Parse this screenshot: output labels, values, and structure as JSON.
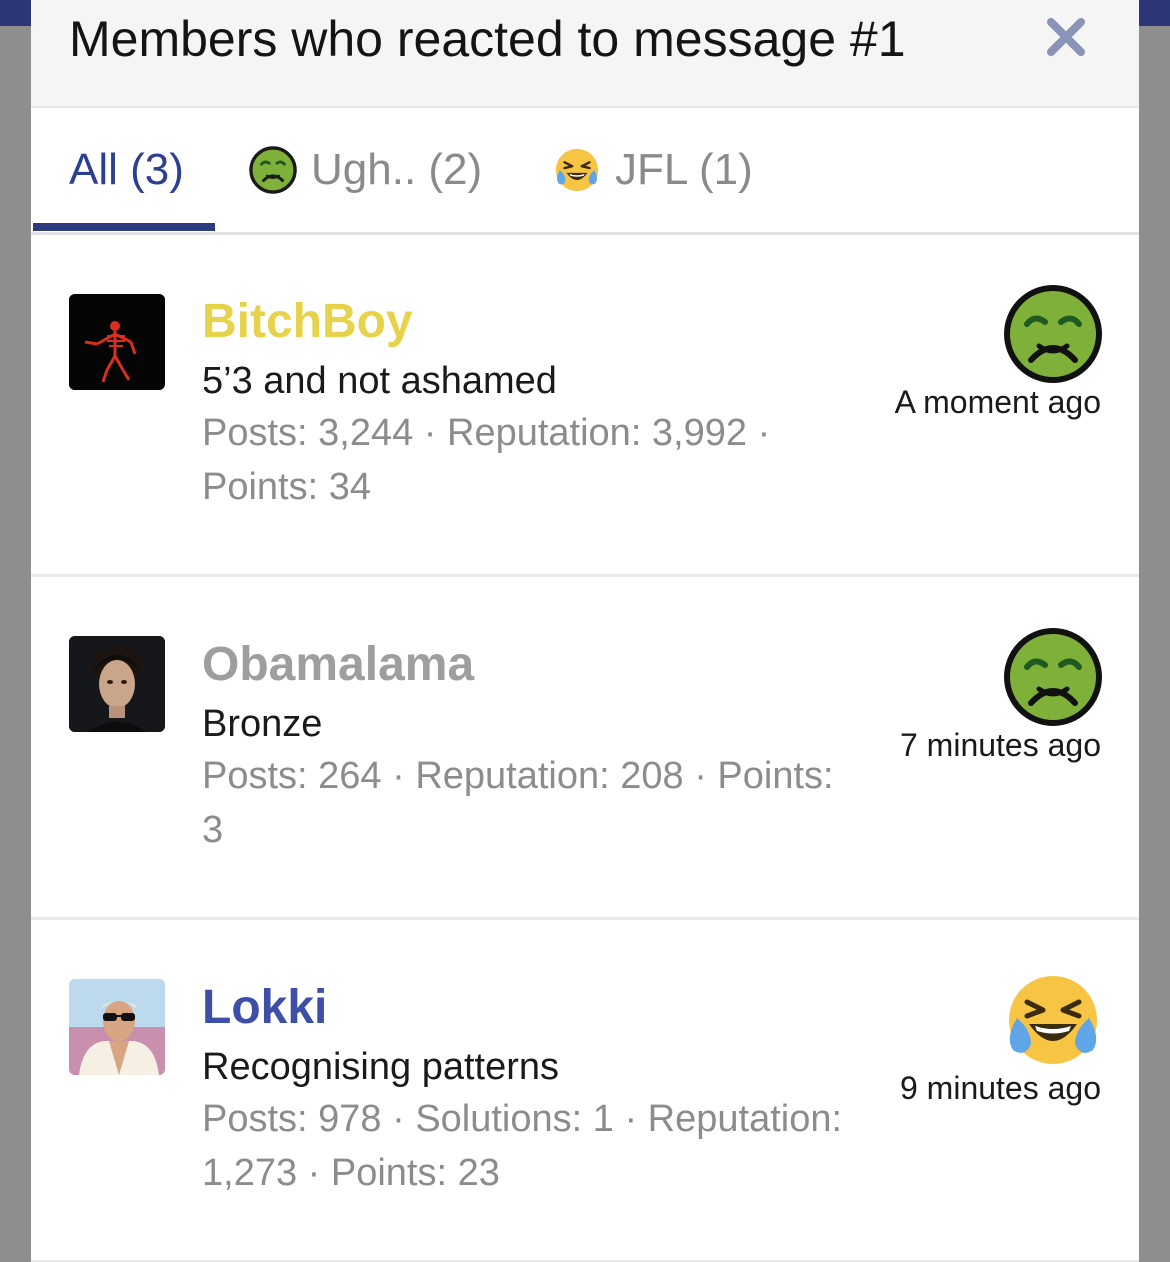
{
  "modal": {
    "title": "Members who reacted to message #1",
    "close_icon": "close-icon"
  },
  "tabs": [
    {
      "label": "All (3)",
      "emoji": null,
      "active": true
    },
    {
      "label": "Ugh.. (2)",
      "emoji": "nauseated-face-icon",
      "active": false
    },
    {
      "label": "JFL (1)",
      "emoji": "tears-of-joy-icon",
      "active": false
    }
  ],
  "members": [
    {
      "username": "BitchBoy",
      "username_color": "#e6d34a",
      "user_title": "5’3 and not ashamed",
      "stats_line1": "Posts: 3,244 · Reputation: 3,992 ·",
      "stats_line2": "Points: 34",
      "reaction": "nauseated-face-icon",
      "time": "A moment ago"
    },
    {
      "username": "Obamalama",
      "username_color": "#9e9e9e",
      "user_title": "Bronze",
      "stats_line1": "Posts: 264 · Reputation: 208 · Points:",
      "stats_line2": "3",
      "reaction": "nauseated-face-icon",
      "time": "7 minutes ago"
    },
    {
      "username": "Lokki",
      "username_color": "#3d4fa8",
      "user_title": "Recognising patterns",
      "stats_line1": "Posts: 978 · Solutions: 1 · Reputation:",
      "stats_line2": "1,273 · Points: 23",
      "reaction": "tears-of-joy-icon",
      "time": "9 minutes ago"
    }
  ],
  "colors": {
    "accent": "#2c3b7d",
    "active_tab_text": "#2d3f8f",
    "inactive_tab_text": "#8a8a8a",
    "stats_text": "#8c8c8c"
  }
}
